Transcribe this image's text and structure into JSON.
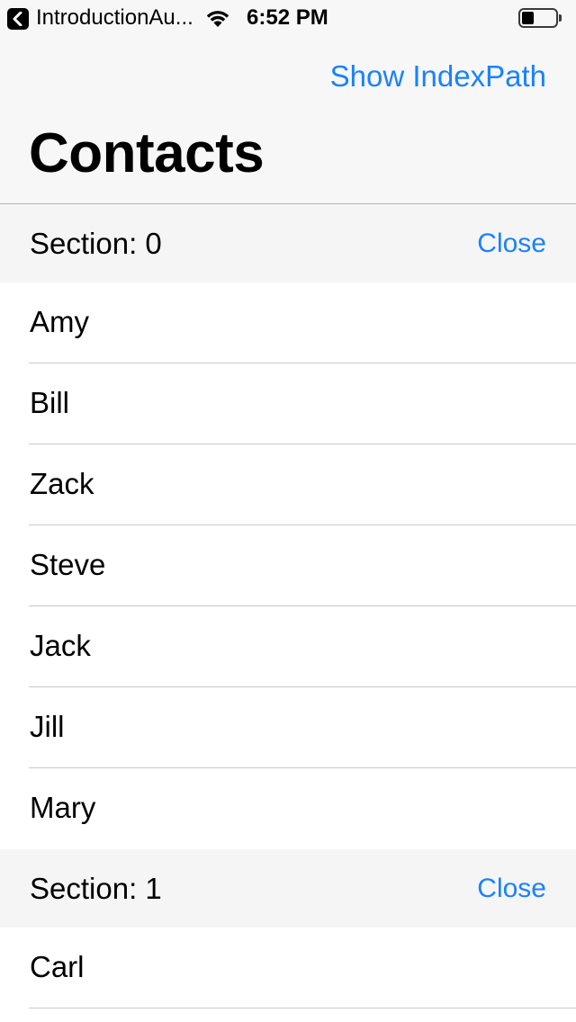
{
  "status_bar": {
    "back_app": "IntroductionAu...",
    "time": "6:52 PM",
    "battery_level": 0.35
  },
  "nav": {
    "action_label": "Show IndexPath",
    "title": "Contacts"
  },
  "sections": [
    {
      "title": "Section: 0",
      "close_label": "Close",
      "rows": [
        "Amy",
        "Bill",
        "Zack",
        "Steve",
        "Jack",
        "Jill",
        "Mary"
      ]
    },
    {
      "title": "Section: 1",
      "close_label": "Close",
      "rows": [
        "Carl"
      ]
    }
  ],
  "colors": {
    "tint": "#1a82fb",
    "bar_background": "#f7f7f7",
    "section_background": "#f5f5f5"
  }
}
